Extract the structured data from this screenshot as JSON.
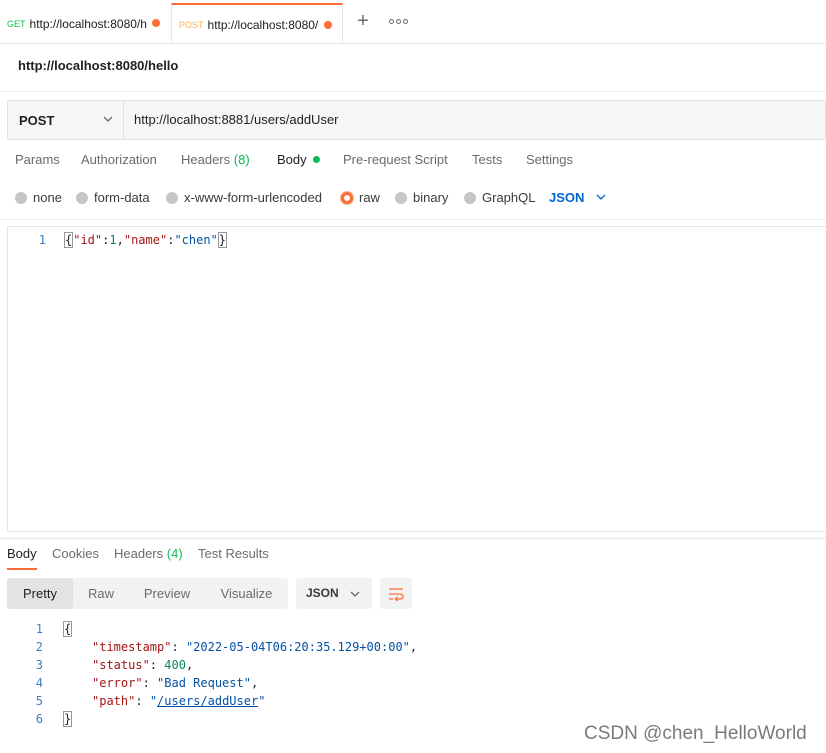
{
  "tabs": [
    {
      "method": "GET",
      "url": "http://localhost:8080/h"
    },
    {
      "method": "POST",
      "url": "http://localhost:8080/"
    }
  ],
  "request_name": "http://localhost:8080/hello",
  "request": {
    "method": "POST",
    "url": "http://localhost:8881/users/addUser"
  },
  "request_tabs": {
    "params": "Params",
    "authorization": "Authorization",
    "headers": "Headers",
    "headers_count": "(8)",
    "body": "Body",
    "prerequest": "Pre-request Script",
    "tests": "Tests",
    "settings": "Settings"
  },
  "body_types": {
    "none": "none",
    "form_data": "form-data",
    "urlencoded": "x-www-form-urlencoded",
    "raw": "raw",
    "binary": "binary",
    "graphql": "GraphQL",
    "selected": "raw",
    "format": "JSON"
  },
  "request_body": {
    "line_number": "1",
    "open": "{",
    "key1": "\"id\"",
    "colon1": ":",
    "val1": "1",
    "comma1": ",",
    "key2": "\"name\"",
    "colon2": ":",
    "val2": "\"chen\"",
    "close": "}"
  },
  "response_tabs": {
    "body": "Body",
    "cookies": "Cookies",
    "headers": "Headers",
    "headers_count": "(4)",
    "test_results": "Test Results"
  },
  "response_view": {
    "pretty": "Pretty",
    "raw": "Raw",
    "preview": "Preview",
    "visualize": "Visualize",
    "format": "JSON"
  },
  "response_body": {
    "line_numbers": [
      "1",
      "2",
      "3",
      "4",
      "5",
      "6"
    ],
    "open": "{",
    "timestamp_key": "\"timestamp\"",
    "timestamp_val": "\"2022-05-04T06:20:35.129+00:00\"",
    "status_key": "\"status\"",
    "status_val": "400",
    "error_key": "\"error\"",
    "error_val": "\"Bad Request\"",
    "path_key": "\"path\"",
    "path_val_open": "\"",
    "path_val_link": "/users/addUser",
    "path_val_close": "\"",
    "close": "}"
  },
  "watermark": "CSDN @chen_HelloWorld",
  "colors": {
    "accent": "#ff6c37",
    "get_method": "#0cbb52",
    "post_method": "#f7b45a",
    "json_select": "#0265d2"
  }
}
